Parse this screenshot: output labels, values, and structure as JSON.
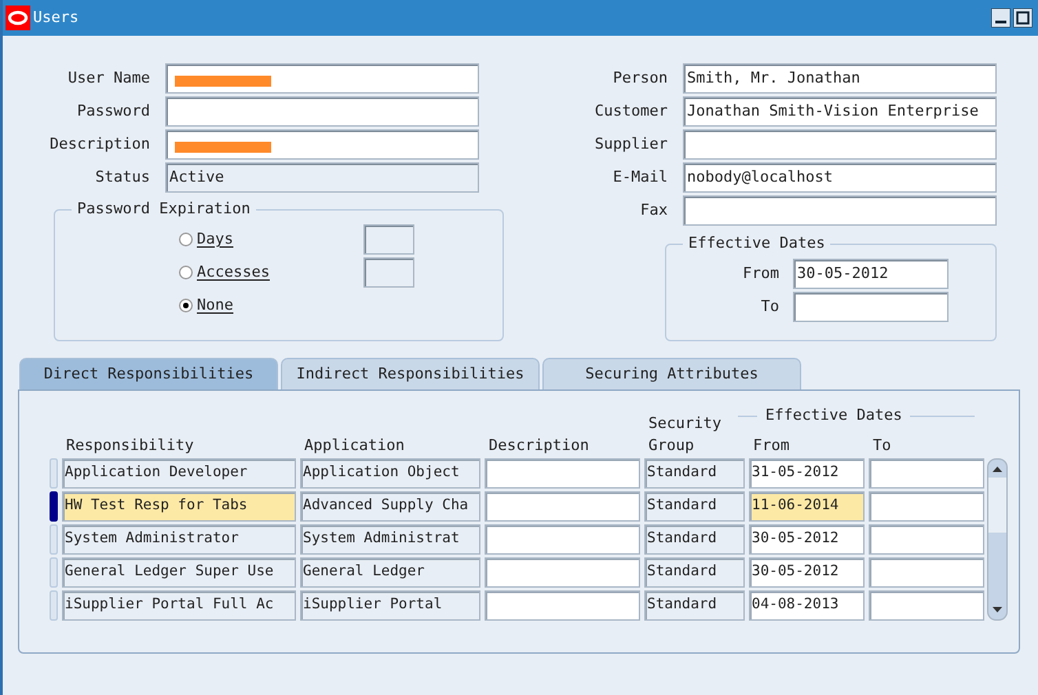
{
  "window": {
    "title": "Users"
  },
  "left_fields": [
    {
      "label": "User Name",
      "redacted": true,
      "readonly": false
    },
    {
      "label": "Password",
      "redacted": false,
      "readonly": false
    },
    {
      "label": "Description",
      "redacted": true,
      "readonly": false
    },
    {
      "label": "Status",
      "value": "Active",
      "redacted": false,
      "readonly": true
    }
  ],
  "right_fields": [
    {
      "label": "Person",
      "value": "Smith, Mr. Jonathan"
    },
    {
      "label": "Customer",
      "value": "Jonathan Smith-Vision Enterprise"
    },
    {
      "label": "Supplier"
    },
    {
      "label": "E-Mail",
      "value": "nobody@localhost"
    },
    {
      "label": "Fax"
    }
  ],
  "password_expiration": {
    "title": "Password Expiration",
    "options": [
      {
        "label": "Days",
        "selected": false,
        "has_field": true
      },
      {
        "label": "Accesses",
        "selected": false,
        "has_field": true
      },
      {
        "label": "None",
        "selected": true,
        "has_field": false
      }
    ]
  },
  "effective_dates": {
    "title": "Effective Dates",
    "from_label": "From",
    "from": "30-05-2012",
    "to_label": "To"
  },
  "tabs": [
    {
      "label": "Direct Responsibilities",
      "selected": true
    },
    {
      "label": "Indirect Responsibilities",
      "selected": false
    },
    {
      "label": "Securing Attributes",
      "selected": false
    }
  ],
  "table": {
    "group_heading": "Effective Dates",
    "columns": [
      {
        "label": "Responsibility"
      },
      {
        "label": "Application"
      },
      {
        "label": "Description"
      },
      {
        "label": "Security",
        "label2": "Group"
      },
      {
        "label": "From"
      },
      {
        "label": "To"
      }
    ],
    "rows": [
      {
        "selected": false,
        "cells": [
          "Application Developer",
          "Application Object",
          null,
          "Standard",
          "31-05-2012",
          null
        ]
      },
      {
        "selected": true,
        "cells": [
          "HW Test Resp for Tabs",
          "Advanced Supply Cha",
          null,
          "Standard",
          "11-06-2014",
          null
        ]
      },
      {
        "selected": false,
        "cells": [
          "System Administrator",
          "System Administrat",
          null,
          "Standard",
          "30-05-2012",
          null
        ]
      },
      {
        "selected": false,
        "cells": [
          "General Ledger Super Use",
          "General Ledger",
          null,
          "Standard",
          "30-05-2012",
          null
        ]
      },
      {
        "selected": false,
        "cells": [
          "iSupplier Portal Full Ac",
          "iSupplier Portal",
          null,
          "Standard",
          "04-08-2013",
          null
        ]
      }
    ]
  }
}
